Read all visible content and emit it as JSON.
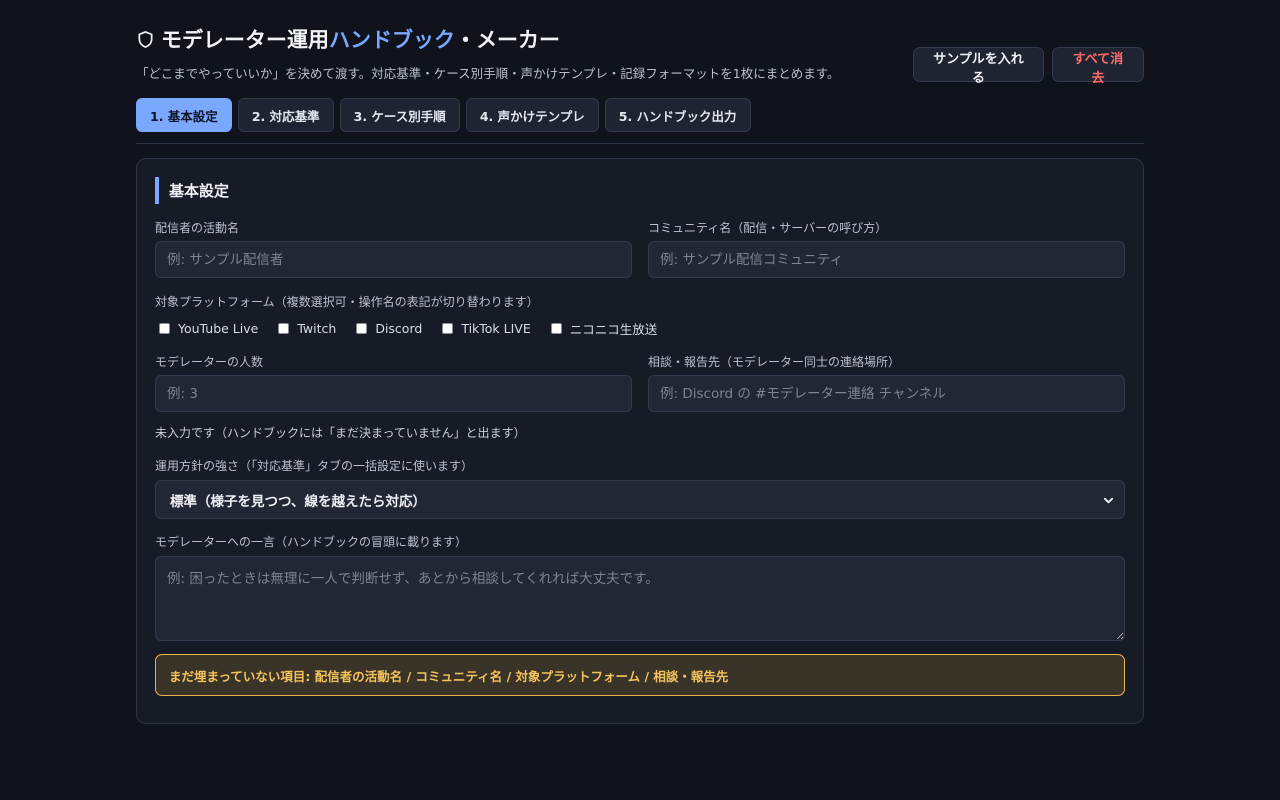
{
  "header": {
    "title_pre": "モデレーター運用",
    "title_accent": "ハンドブック",
    "title_post": "・メーカー",
    "subtitle": "「どこまでやっていいか」を決めて渡す。対応基準・ケース別手順・声かけテンプレ・記録フォーマットを1枚にまとめます。",
    "sample_button": "サンプルを入れる",
    "clear_button": "すべて消去"
  },
  "tabs": [
    {
      "label": "1. 基本設定",
      "active": true
    },
    {
      "label": "2. 対応基準",
      "active": false
    },
    {
      "label": "3. ケース別手順",
      "active": false
    },
    {
      "label": "4. 声かけテンプレ",
      "active": false
    },
    {
      "label": "5. ハンドブック出力",
      "active": false
    }
  ],
  "section": {
    "title": "基本設定"
  },
  "fields": {
    "streamer_name": {
      "label": "配信者の活動名",
      "placeholder": "例: サンプル配信者",
      "value": ""
    },
    "community_name": {
      "label": "コミュニティ名（配信・サーバーの呼び方）",
      "placeholder": "例: サンプル配信コミュニティ",
      "value": ""
    },
    "platforms": {
      "label": "対象プラットフォーム（複数選択可・操作名の表記が切り替わります）",
      "options": [
        "YouTube Live",
        "Twitch",
        "Discord",
        "TikTok LIVE",
        "ニコニコ生放送"
      ]
    },
    "mod_count": {
      "label": "モデレーターの人数",
      "placeholder": "例: 3",
      "value": ""
    },
    "report_channel": {
      "label": "相談・報告先（モデレーター同士の連絡場所）",
      "placeholder": "例: Discord の #モデレーター連絡 チャンネル",
      "value": ""
    },
    "empty_note": "未入力です（ハンドブックには「まだ決まっていません」と出ます）",
    "policy": {
      "label": "運用方針の強さ（「対応基準」タブの一括設定に使います）",
      "selected": "標準（様子を見つつ、線を越えたら対応）"
    },
    "message": {
      "label": "モデレーターへの一言（ハンドブックの冒頭に載ります）",
      "placeholder": "例: 困ったときは無理に一人で判断せず、あとから相談してくれれば大丈夫です。"
    }
  },
  "warning": "まだ埋まっていない項目: 配信者の活動名 / コミュニティ名 / 対象プラットフォーム / 相談・報告先",
  "colors": {
    "accent": "#7aa7ff",
    "danger": "#ff6b6b",
    "warning": "#f3c25d"
  }
}
